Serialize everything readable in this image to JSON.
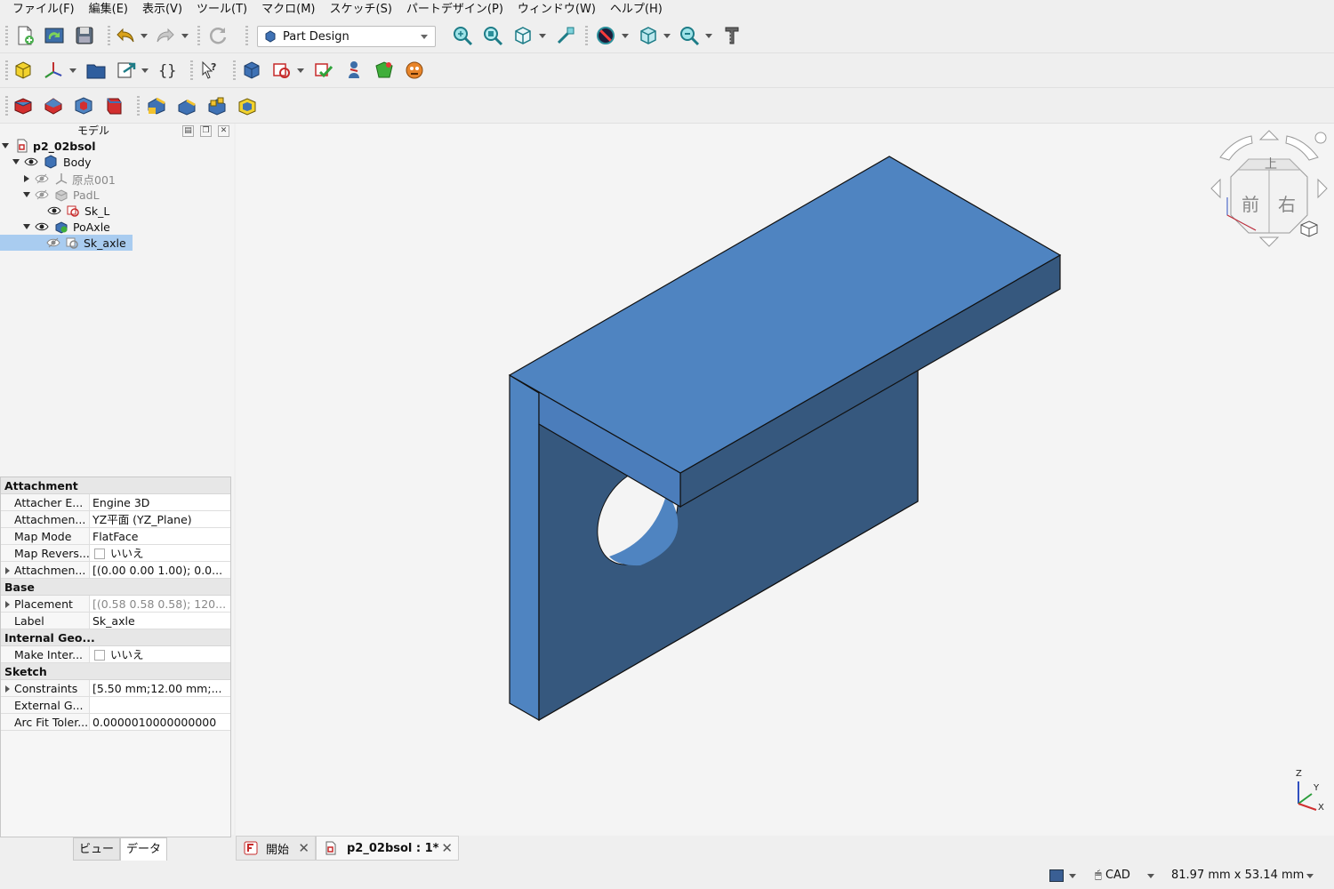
{
  "menu": [
    "ファイル(F)",
    "編集(E)",
    "表示(V)",
    "ツール(T)",
    "マクロ(M)",
    "スケッチ(S)",
    "パートデザイン(P)",
    "ウィンドウ(W)",
    "ヘルプ(H)"
  ],
  "workbench": {
    "selected": "Part Design"
  },
  "model_panel": {
    "title": "モデル",
    "tree": {
      "document": "p2_02bsol",
      "body": "Body",
      "origin": "原点001",
      "pad": "PadL",
      "sketch_l": "Sk_L",
      "pocket": "PoAxle",
      "sketch_axle": "Sk_axle"
    }
  },
  "properties": {
    "groups": {
      "attachment": "Attachment",
      "base": "Base",
      "internal": "Internal Geo...",
      "sketch": "Sketch"
    },
    "rows": {
      "attacher_engine": {
        "key": "Attacher E...",
        "value": "Engine 3D"
      },
      "attachment_support": {
        "key": "Attachmen...",
        "value": "YZ平面 (YZ_Plane)"
      },
      "map_mode": {
        "key": "Map Mode",
        "value": "FlatFace"
      },
      "map_reversed": {
        "key": "Map Revers...",
        "value": "いいえ"
      },
      "attachment_offset": {
        "key": "Attachmen...",
        "value": "[(0.00 0.00 1.00); 0.0..."
      },
      "placement": {
        "key": "Placement",
        "value": "[(0.58 0.58 0.58); 120..."
      },
      "label": {
        "key": "Label",
        "value": "Sk_axle"
      },
      "make_internals": {
        "key": "Make Inter...",
        "value": "いいえ"
      },
      "constraints": {
        "key": "Constraints",
        "value": "[5.50 mm;12.00 mm;..."
      },
      "external_geo": {
        "key": "External G...",
        "value": ""
      },
      "arc_fit_tolerance": {
        "key": "Arc Fit Toler...",
        "value": "0.0000010000000000"
      }
    }
  },
  "panel_tabs": {
    "view": "ビュー",
    "data": "データ"
  },
  "nav_cube": {
    "top": "上",
    "front": "前",
    "right": "右"
  },
  "axis": {
    "z": "Z",
    "y": "Y",
    "x": "X"
  },
  "doc_tabs": {
    "start": "開始",
    "doc": "p2_02bsol : 1*"
  },
  "status": {
    "nav_style": "CAD",
    "dimensions": "81.97 mm x 53.14 mm"
  },
  "colors": {
    "face_top": "#4f84c1",
    "face_side": "#36587e",
    "face_front": "#4b7dbb",
    "selection": "#a9ccf0"
  }
}
